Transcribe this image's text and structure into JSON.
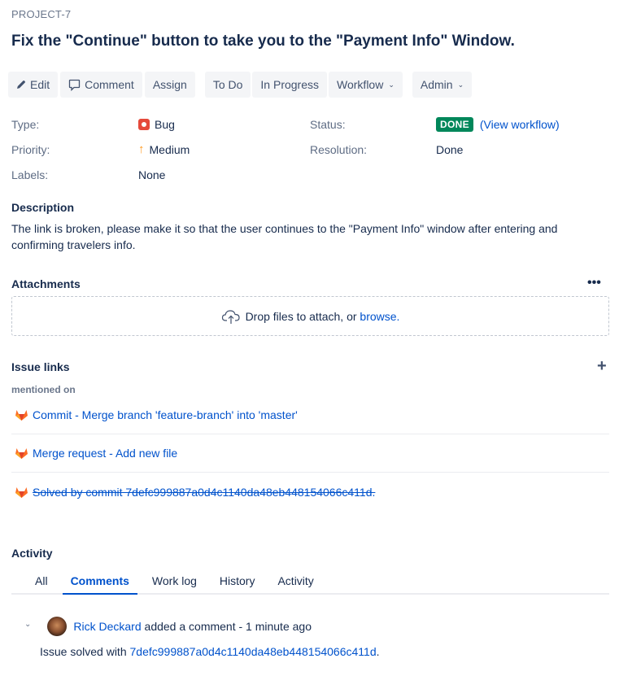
{
  "issue": {
    "key": "PROJECT-7",
    "title": "Fix the \"Continue\" button to take you to the \"Payment Info\" Window."
  },
  "toolbar": {
    "edit": "Edit",
    "comment": "Comment",
    "assign": "Assign",
    "todo": "To Do",
    "in_progress": "In Progress",
    "workflow": "Workflow",
    "admin": "Admin"
  },
  "fields": {
    "type_label": "Type:",
    "type_value": "Bug",
    "priority_label": "Priority:",
    "priority_value": "Medium",
    "labels_label": "Labels:",
    "labels_value": "None",
    "status_label": "Status:",
    "status_value": "DONE",
    "view_workflow": "(View workflow)",
    "resolution_label": "Resolution:",
    "resolution_value": "Done"
  },
  "description": {
    "heading": "Description",
    "text": "The link is broken, please make it so that the user continues to the \"Payment Info\" window after entering and confirming travelers info."
  },
  "attachments": {
    "heading": "Attachments",
    "drop_text": "Drop files to attach, or ",
    "browse": "browse."
  },
  "issue_links": {
    "heading": "Issue links",
    "group_label": "mentioned on",
    "links": [
      {
        "text": "Commit - Merge branch 'feature-branch' into 'master'",
        "resolved": false
      },
      {
        "text": "Merge request - Add new file",
        "resolved": false
      },
      {
        "text": "Solved by commit 7defc999887a0d4c1140da48eb448154066c411d.",
        "resolved": true
      }
    ]
  },
  "activity": {
    "heading": "Activity",
    "tabs": [
      "All",
      "Comments",
      "Work log",
      "History",
      "Activity"
    ],
    "active_tab": "Comments",
    "comments": [
      {
        "author": "Rick Deckard",
        "action": " added a comment - 1 minute ago",
        "body_prefix": "Issue solved with ",
        "body_link": "7defc999887a0d4c1140da48eb448154066c411d",
        "body_suffix": "."
      }
    ]
  },
  "colors": {
    "link": "#0052cc",
    "done_lozenge": "#00875a",
    "bug": "#e5493a",
    "priority_medium": "#ff991f"
  }
}
